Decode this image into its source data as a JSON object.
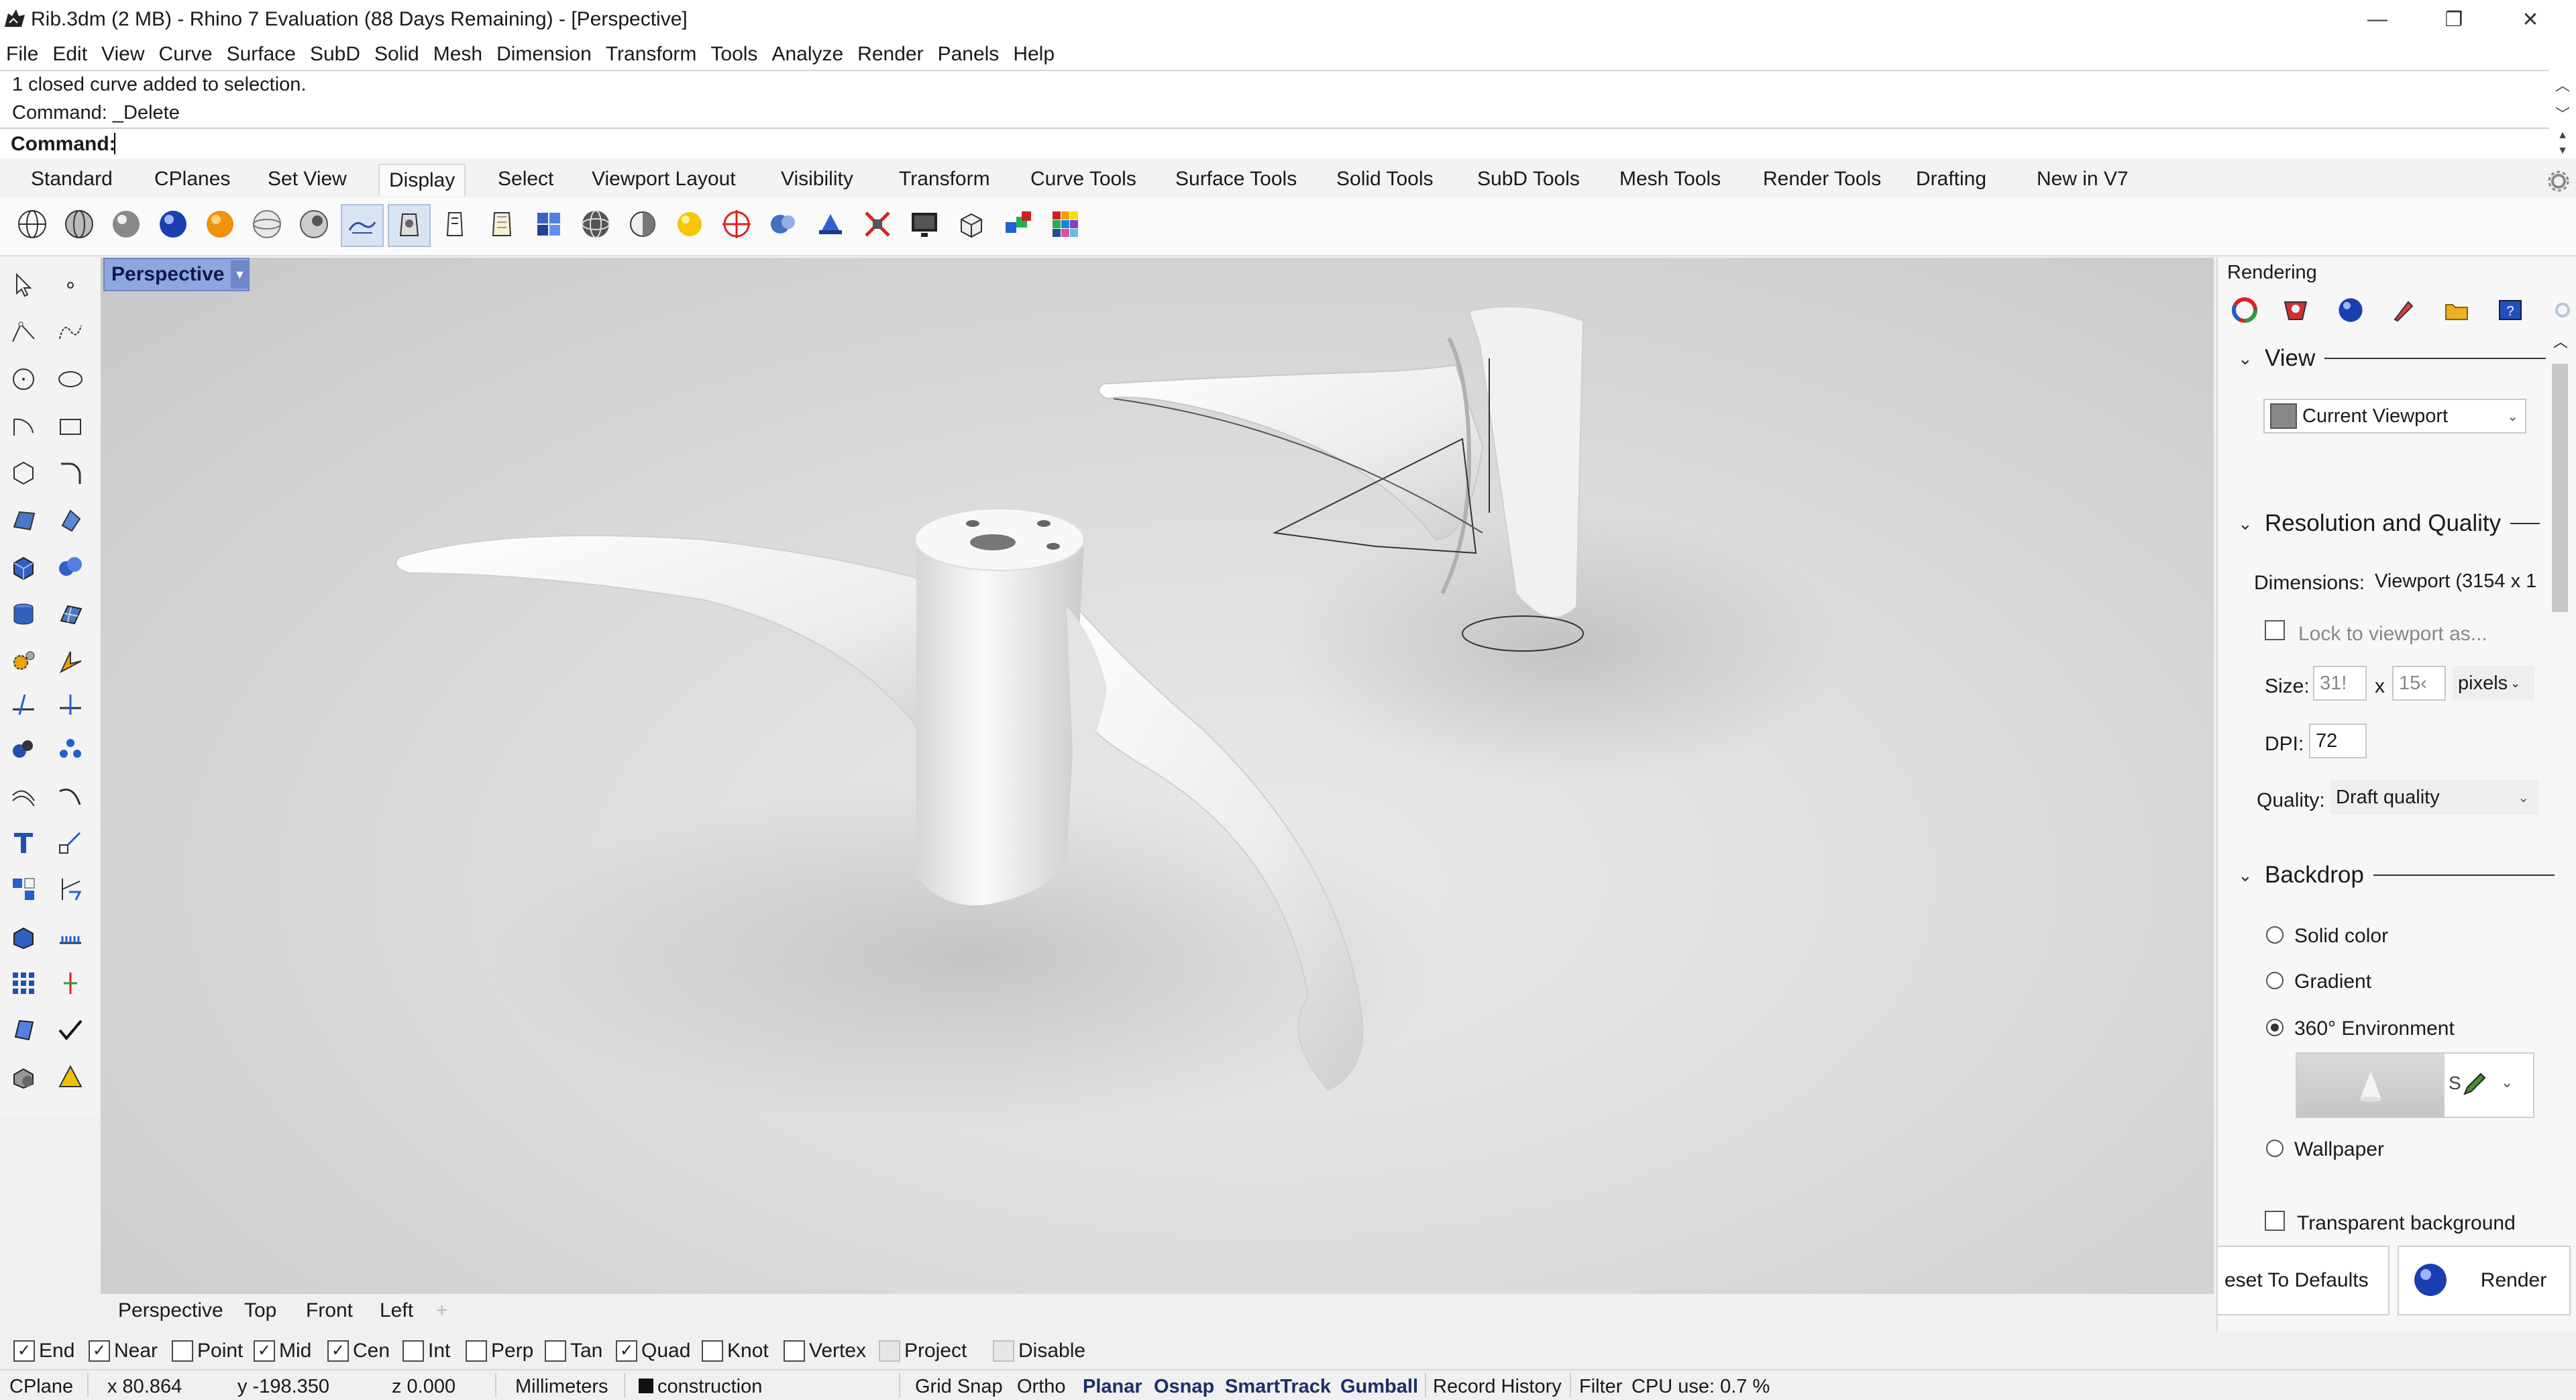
{
  "window": {
    "title": "Rib.3dm (2 MB) - Rhino 7 Evaluation (88 Days Remaining) - [Perspective]",
    "minimize": "—",
    "restore": "❐",
    "close": "✕"
  },
  "menu": [
    "File",
    "Edit",
    "View",
    "Curve",
    "Surface",
    "SubD",
    "Solid",
    "Mesh",
    "Dimension",
    "Transform",
    "Tools",
    "Analyze",
    "Render",
    "Panels",
    "Help"
  ],
  "command": {
    "history": [
      "1 closed curve added to selection.",
      "Command: _Delete"
    ],
    "prompt": "Command:"
  },
  "toolbar_tabs": [
    "Standard",
    "CPlanes",
    "Set View",
    "Display",
    "Select",
    "Viewport Layout",
    "Visibility",
    "Transform",
    "Curve Tools",
    "Surface Tools",
    "Solid Tools",
    "SubD Tools",
    "Mesh Tools",
    "Render Tools",
    "Drafting",
    "New in V7"
  ],
  "active_tab": "Display",
  "display_icons": [
    "wireframe-icon",
    "shaded-icon",
    "rendered-icon",
    "rendered-blue-icon",
    "gold-sphere-icon",
    "ghosted-icon",
    "xray-icon",
    "technical-icon",
    "artistic-icon",
    "pen-icon",
    "arctic-icon",
    "monochrome-icon",
    "raytraced-icon",
    "half-sphere-icon",
    "light-bulb-icon",
    "zebra-icon",
    "environment-map-icon",
    "draft-angle-icon",
    "curvature-icon",
    "emap-off-icon",
    "monitor-icon",
    "box-edges-icon",
    "colored-cubes-icon",
    "color-grid-icon"
  ],
  "viewport": {
    "title": "Perspective",
    "tabs": [
      "Perspective",
      "Top",
      "Front",
      "Left"
    ],
    "add_tab": "+"
  },
  "osnaps": [
    {
      "label": "End",
      "checked": true
    },
    {
      "label": "Near",
      "checked": true
    },
    {
      "label": "Point",
      "checked": false
    },
    {
      "label": "Mid",
      "checked": true
    },
    {
      "label": "Cen",
      "checked": true
    },
    {
      "label": "Int",
      "checked": false
    },
    {
      "label": "Perp",
      "checked": false
    },
    {
      "label": "Tan",
      "checked": false
    },
    {
      "label": "Quad",
      "checked": true
    },
    {
      "label": "Knot",
      "checked": false
    },
    {
      "label": "Vertex",
      "checked": false
    },
    {
      "label": "Project",
      "checked": false
    },
    {
      "label": "Disable",
      "checked": false
    }
  ],
  "status": {
    "cplane": "CPlane",
    "x": "x 80.864",
    "y": "y -198.350",
    "z": "z 0.000",
    "units": "Millimeters",
    "layer": "construction",
    "grid_snap": "Grid Snap",
    "ortho": "Ortho",
    "planar": "Planar",
    "osnap": "Osnap",
    "smarttrack": "SmartTrack",
    "gumball": "Gumball",
    "record_history": "Record History",
    "filter": "Filter",
    "cpu": "CPU use: 0.7 %"
  },
  "rendering_panel": {
    "title": "Rendering",
    "view_section": "View",
    "view_value": "Current Viewport",
    "resolution_section": "Resolution and Quality",
    "dimensions_label": "Dimensions:",
    "dimensions_value": "Viewport (3154 x 1",
    "lock_label": "Lock to viewport as...",
    "size_label": "Size:",
    "size_w": "31!",
    "size_x": "x",
    "size_h": "15‹",
    "size_units": "pixels",
    "dpi_label": "DPI:",
    "dpi_value": "72",
    "quality_label": "Quality:",
    "quality_value": "Draft quality",
    "backdrop_section": "Backdrop",
    "backdrop_options": [
      {
        "label": "Solid color",
        "selected": false
      },
      {
        "label": "Gradient",
        "selected": false
      },
      {
        "label": "360° Environment",
        "selected": true
      },
      {
        "label": "Wallpaper",
        "selected": false
      }
    ],
    "env_name": "S",
    "transparent_label": "Transparent background",
    "reset_label": "eset To Defaults",
    "render_label": "Render"
  }
}
